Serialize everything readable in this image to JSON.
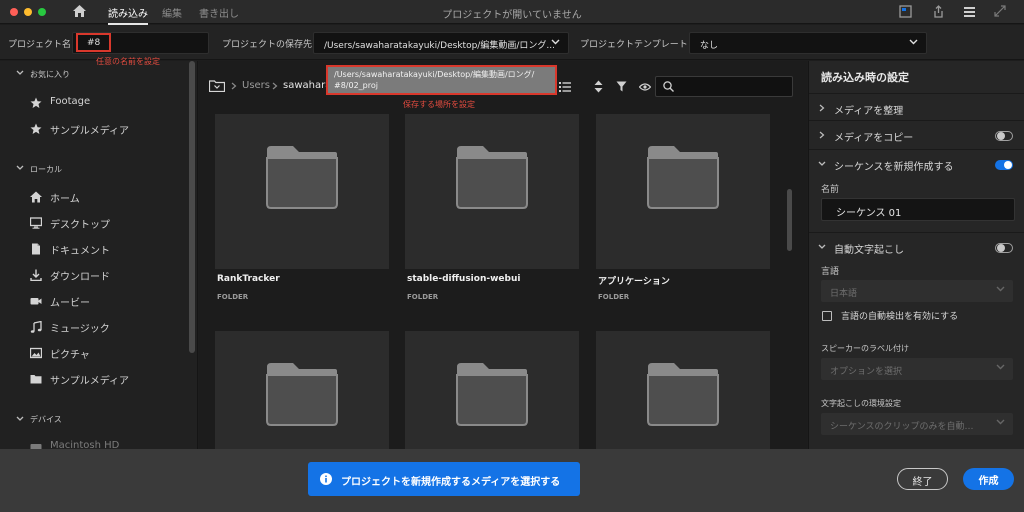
{
  "titlebar": {
    "tabs": [
      {
        "label": "読み込み",
        "active": true
      },
      {
        "label": "編集",
        "active": false
      },
      {
        "label": "書き出し",
        "active": false
      }
    ],
    "window_title": "プロジェクトが開いていません"
  },
  "projbar": {
    "name_label": "プロジェクト名",
    "name_value": "#8",
    "location_label": "プロジェクトの保存先",
    "location_value": "/Users/sawaharatakayuki/Desktop/編集動画/ロング...",
    "template_label": "プロジェクトテンプレート",
    "template_value": "なし"
  },
  "annotations": {
    "name_note": "任意の名前を設定",
    "location_note": "保存する場所を設定",
    "tooltip_line1": "/Users/sawaharatakayuki/Desktop/編集動画/ロング/",
    "tooltip_line2": "#8/02_proj"
  },
  "sidebar": {
    "favorites_label": "お気に入り",
    "favorites": [
      {
        "label": "Footage",
        "icon": "star-icon"
      },
      {
        "label": "サンプルメディア",
        "icon": "star-icon"
      }
    ],
    "local_label": "ローカル",
    "local": [
      {
        "label": "ホーム",
        "icon": "home-icon"
      },
      {
        "label": "デスクトップ",
        "icon": "desktop-icon"
      },
      {
        "label": "ドキュメント",
        "icon": "document-icon"
      },
      {
        "label": "ダウンロード",
        "icon": "download-icon"
      },
      {
        "label": "ムービー",
        "icon": "movie-icon"
      },
      {
        "label": "ミュージック",
        "icon": "music-icon"
      },
      {
        "label": "ピクチャ",
        "icon": "picture-icon"
      },
      {
        "label": "サンプルメディア",
        "icon": "folder-icon"
      }
    ],
    "devices_label": "デバイス",
    "devices": [
      {
        "label": "Macintosh HD",
        "icon": "drive-icon"
      }
    ]
  },
  "browser": {
    "breadcrumb": [
      "Users",
      "sawaharat"
    ],
    "tiles": [
      {
        "name": "RankTracker",
        "kind": "FOLDER"
      },
      {
        "name": "stable-diffusion-webui",
        "kind": "FOLDER"
      },
      {
        "name": "アプリケーション",
        "kind": "FOLDER"
      },
      {
        "name": "",
        "kind": ""
      },
      {
        "name": "",
        "kind": ""
      },
      {
        "name": "",
        "kind": ""
      }
    ]
  },
  "rpanel": {
    "title": "読み込み時の設定",
    "organize_media": "メディアを整理",
    "copy_media": "メディアをコピー",
    "copy_media_on": false,
    "new_sequence": "シーケンスを新規作成する",
    "new_sequence_on": true,
    "name_label": "名前",
    "sequence_name": "シーケンス 01",
    "auto_transcribe": "自動文字起こし",
    "auto_transcribe_on": false,
    "language_label": "言語",
    "language_value": "日本語",
    "auto_detect_label": "言語の自動検出を有効にする",
    "speaker_label": "スピーカーのラベル付け",
    "speaker_value": "オプションを選択",
    "env_label": "文字起こしの環境設定",
    "env_value": "シーケンスのクリップのみを自動…"
  },
  "footer": {
    "banner_text": "プロジェクトを新規作成するメディアを選択する",
    "exit_label": "終了",
    "create_label": "作成"
  },
  "colors": {
    "accent": "#1473e6",
    "annotation": "#d9382c"
  }
}
